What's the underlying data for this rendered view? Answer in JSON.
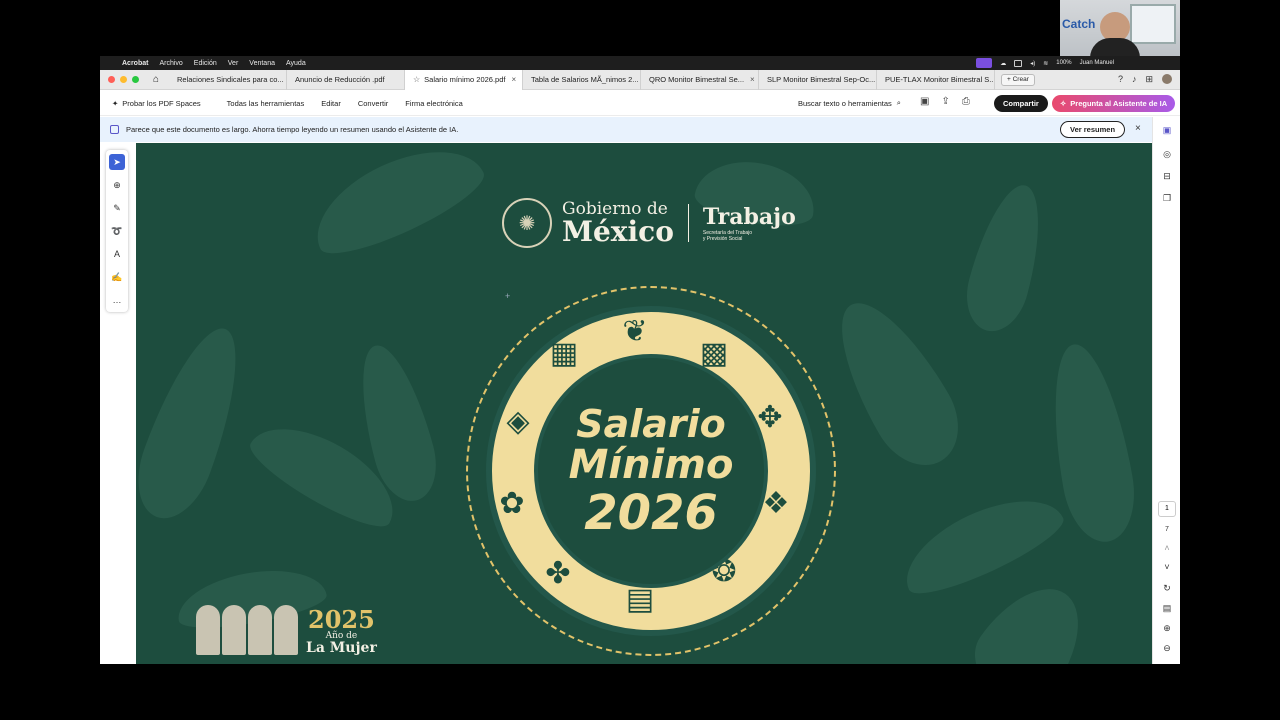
{
  "menubar": {
    "app": "Acrobat",
    "items": [
      "Archivo",
      "Edición",
      "Ver",
      "Ventana",
      "Ayuda"
    ],
    "battery": "100%"
  },
  "tabs": [
    {
      "label": "Relaciones Sindicales para co..."
    },
    {
      "label": "Anuncio de Reducción .pdf"
    },
    {
      "label": "Salario mínimo 2026.pdf",
      "active": true
    },
    {
      "label": "Tabla de Salarios MÃ_nimos 2..."
    },
    {
      "label": "QRO Monitor Bimestral Se..."
    },
    {
      "label": "SLP Monitor Bimestral Sep-Oc..."
    },
    {
      "label": "PUE-TLAX Monitor Bimestral S..."
    }
  ],
  "new_tab_label": "Crear",
  "toolbar": {
    "pdf_spaces": "Probar los PDF Spaces",
    "items": [
      "Todas las herramientas",
      "Editar",
      "Convertir",
      "Firma electrónica"
    ],
    "search": "Buscar texto o herramientas",
    "share": "Compartir",
    "ai": "Pregunta al Asistente de IA"
  },
  "banner": {
    "text": "Parece que este documento es largo. Ahorra tiempo leyendo un resumen usando el Asistente de IA.",
    "button": "Ver resumen"
  },
  "page": {
    "current": "1",
    "total": "7"
  },
  "document": {
    "gov_line1": "Gobierno de",
    "gov_line2": "México",
    "dept": "Trabajo",
    "dept_sub1": "Secretaría del Trabajo",
    "dept_sub2": "y Previsión Social",
    "title1": "Salario",
    "title2": "Mínimo",
    "title3": "2026",
    "year": "2025",
    "year_sub": "Año de",
    "year_sub2": "La Mujer"
  },
  "webcam": {
    "logo": "Catch",
    "name": "Juan Manuel"
  },
  "colors": {
    "doc_bg": "#1d4d3e",
    "gold": "#f1dd9d",
    "accent": "#3d63d6"
  }
}
